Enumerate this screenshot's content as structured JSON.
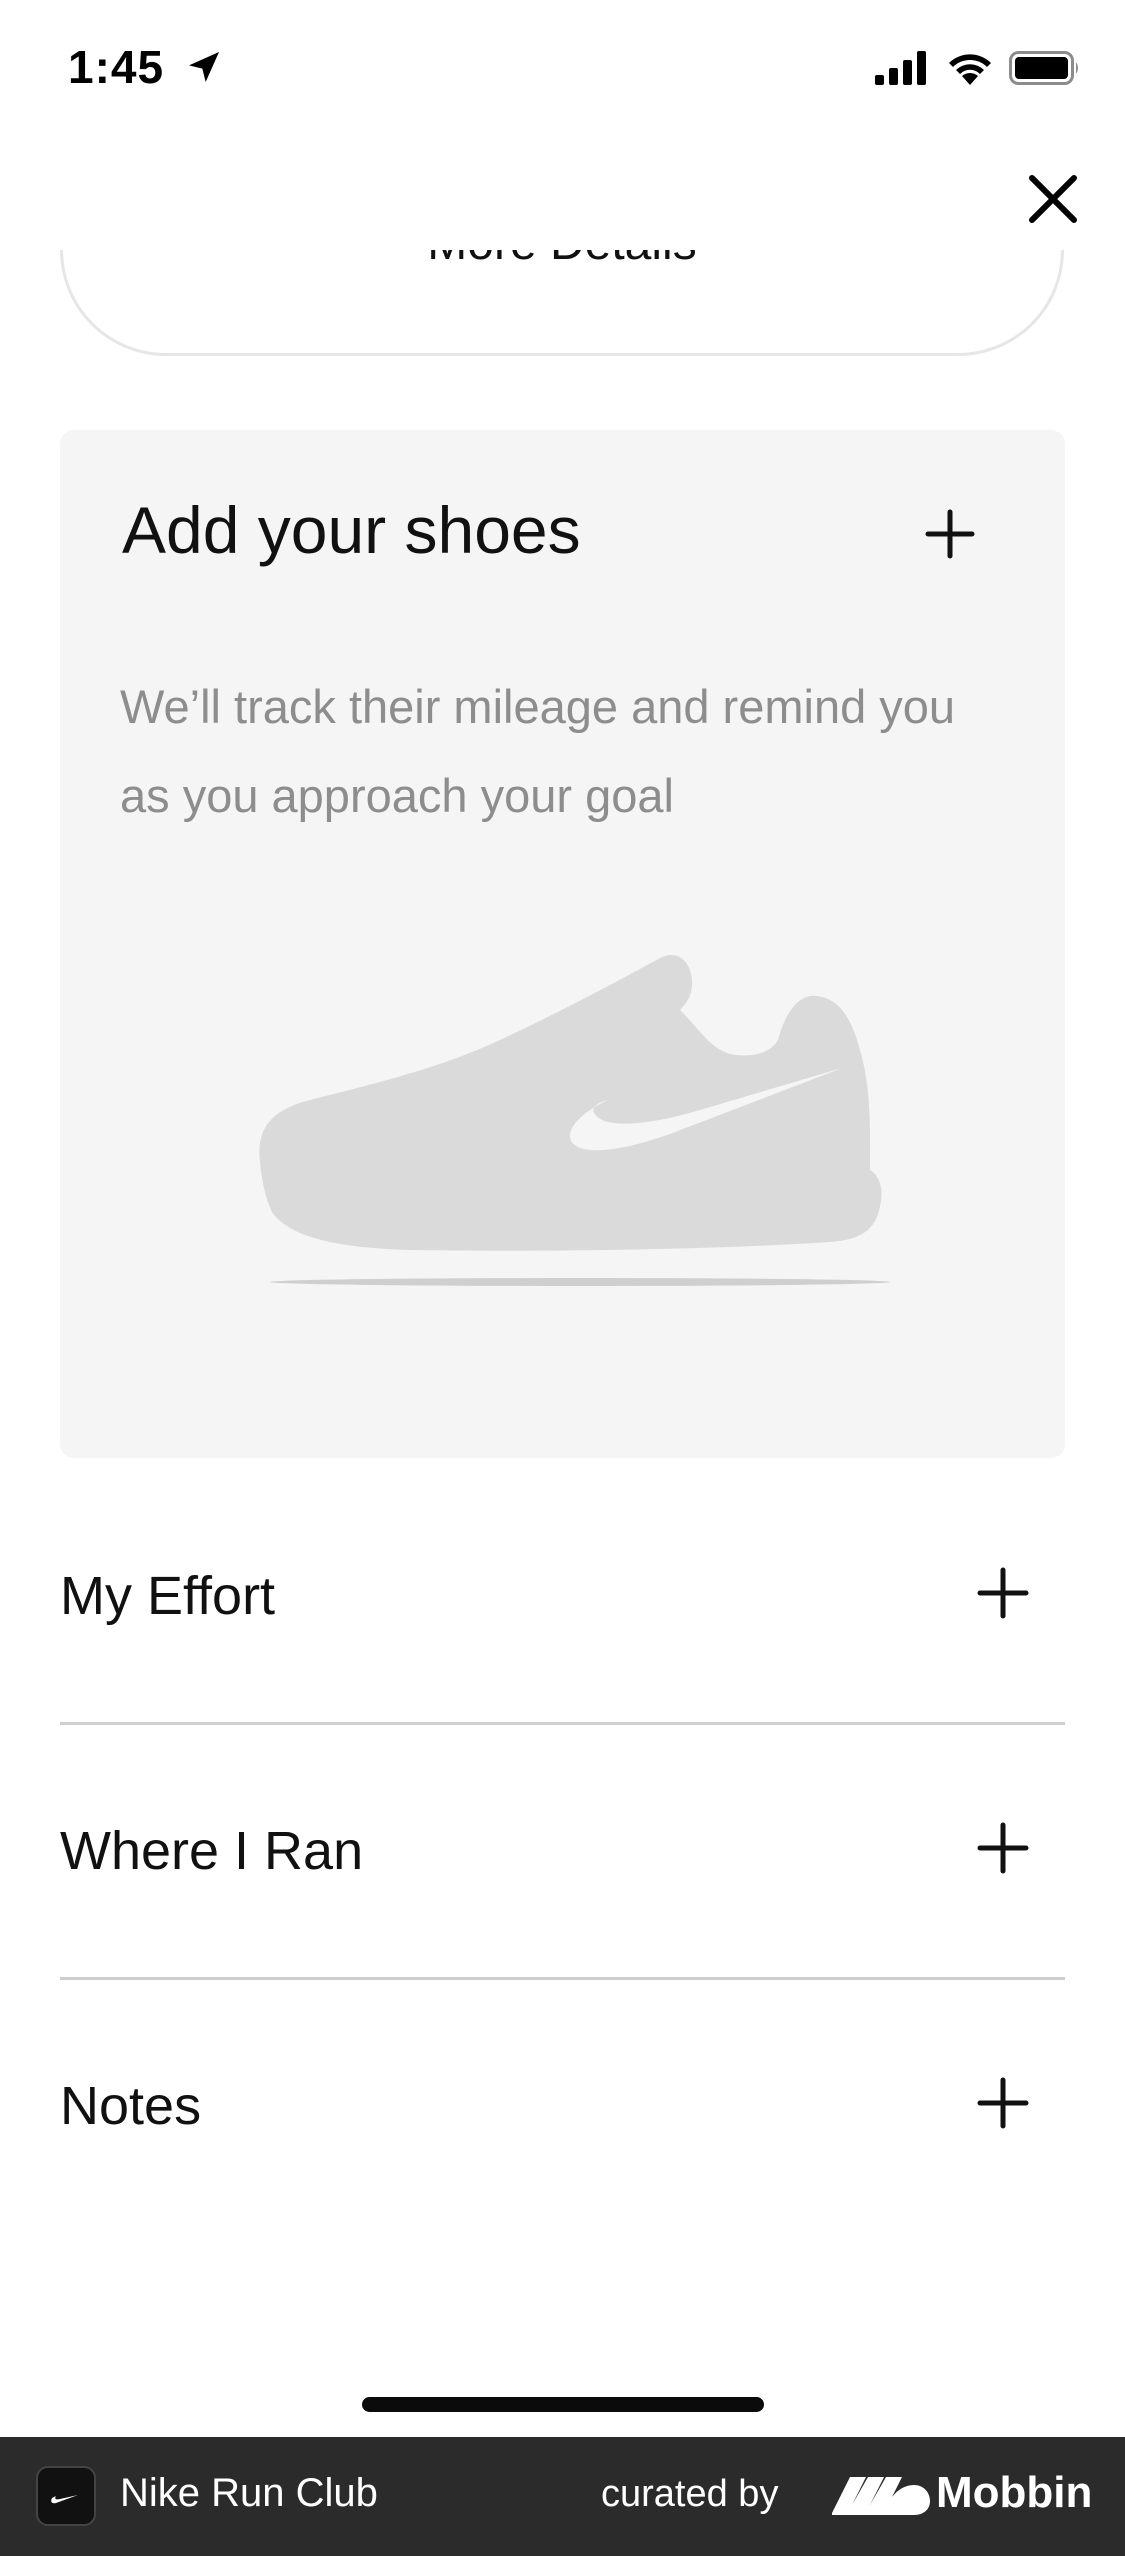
{
  "status_bar": {
    "time": "1:45",
    "icons": [
      "location-arrow-icon",
      "cellular-signal-icon",
      "wifi-icon",
      "battery-icon"
    ]
  },
  "header": {
    "close_icon": "close-icon",
    "more_details_label": "More Details"
  },
  "shoes_card": {
    "title": "Add your shoes",
    "description": "We’ll track their mileage and remind you as you approach your goal",
    "add_icon": "plus-icon",
    "graphic": "shoe-placeholder-illustration"
  },
  "sections": [
    {
      "label": "My Effort",
      "icon": "plus-icon"
    },
    {
      "label": "Where I Ran",
      "icon": "plus-icon"
    },
    {
      "label": "Notes",
      "icon": "plus-icon"
    }
  ],
  "footer": {
    "app_name": "Nike Run Club",
    "curated_by": "curated by",
    "brand": "Mobbin"
  },
  "colors": {
    "card_background": "#f5f5f5",
    "muted_text": "#8d8d8d",
    "divider": "#cfcfcf",
    "footer_background": "#2b2b2b",
    "shoe_placeholder": "#dadada"
  }
}
